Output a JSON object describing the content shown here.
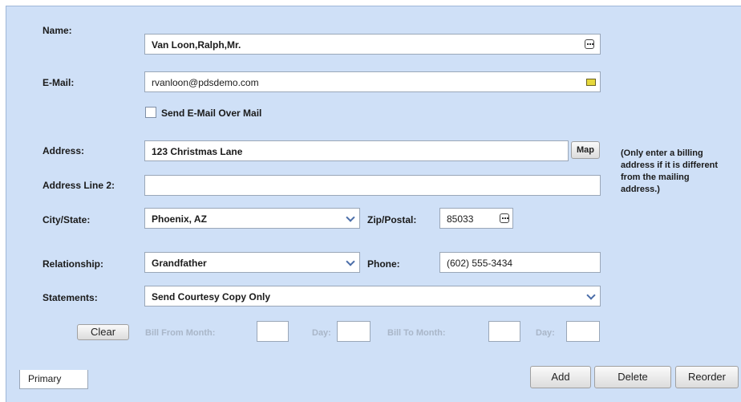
{
  "form": {
    "name": {
      "label": "Name:",
      "value": "Van Loon,Ralph,Mr."
    },
    "email": {
      "label": "E-Mail:",
      "value": "rvanloon@pdsdemo.com"
    },
    "send_email_checkbox": {
      "label": "Send E-Mail Over Mail",
      "checked": false
    },
    "address": {
      "label": "Address:",
      "value": "123 Christmas Lane",
      "map_button": "Map"
    },
    "address_line2": {
      "label": "Address Line 2:",
      "value": ""
    },
    "city_state": {
      "label": "City/State:",
      "value": "Phoenix, AZ"
    },
    "zip": {
      "label": "Zip/Postal:",
      "value": "85033"
    },
    "relationship": {
      "label": "Relationship:",
      "value": "Grandfather"
    },
    "phone": {
      "label": "Phone:",
      "value": "(602) 555-3434"
    },
    "statements": {
      "label": "Statements:",
      "value": "Send Courtesy Copy Only"
    },
    "billing_note": "(Only enter a billing address if it is different from the mailing address.)",
    "clear_button": "Clear",
    "bill_from_month_label": "Bill From Month:",
    "bill_from_day_label": "Day:",
    "bill_to_month_label": "Bill To Month:",
    "bill_to_day_label": "Day:"
  },
  "tabs": [
    {
      "label": "Primary",
      "active": true
    }
  ],
  "actions": {
    "add": "Add",
    "delete": "Delete",
    "reorder": "Reorder"
  },
  "icons": {
    "lookup": "ellipsis-lookup-icon",
    "email": "envelope-icon",
    "dropdown": "chevron-down-icon"
  },
  "colors": {
    "panel_bg": "#cfe0f7",
    "field_border": "#9aa7b8",
    "dropdown_arrow": "#4a6da8"
  }
}
